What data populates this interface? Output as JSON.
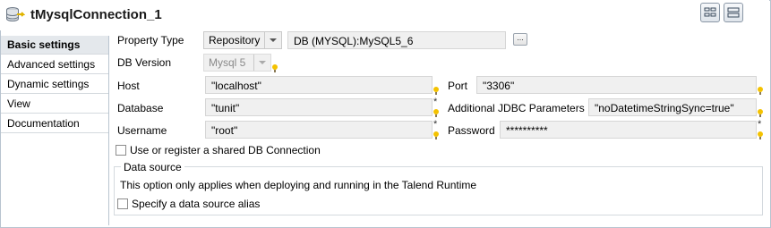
{
  "window": {
    "title": "tMysqlConnection_1",
    "component_icon": "database-icon",
    "view_buttons": [
      "table-layout-icon",
      "form-layout-icon"
    ]
  },
  "sidebar": {
    "items": [
      {
        "label": "Basic settings",
        "active": true
      },
      {
        "label": "Advanced settings",
        "active": false
      },
      {
        "label": "Dynamic settings",
        "active": false
      },
      {
        "label": "View",
        "active": false
      },
      {
        "label": "Documentation",
        "active": false
      }
    ]
  },
  "form": {
    "property_type": {
      "label": "Property Type",
      "value": "Repository",
      "repository_value": "DB (MYSQL):MySQL5_6",
      "browse_label": "..."
    },
    "db_version": {
      "label": "DB Version",
      "value": "Mysql 5"
    },
    "host": {
      "label": "Host",
      "value": "\"localhost\""
    },
    "port": {
      "label": "Port",
      "value": "\"3306\""
    },
    "database": {
      "label": "Database",
      "value": "\"tunit\"",
      "required": "*"
    },
    "jdbc_params": {
      "label": "Additional JDBC Parameters",
      "value": "\"noDatetimeStringSync=true\""
    },
    "username": {
      "label": "Username",
      "value": "\"root\"",
      "required": "*"
    },
    "password": {
      "label": "Password",
      "value": "**********",
      "required": "*"
    },
    "shared_connection": {
      "label": "Use or register a shared DB Connection",
      "checked": false
    }
  },
  "data_source": {
    "title": "Data source",
    "note": "This option only applies when deploying and running in the Talend Runtime",
    "alias": {
      "label": "Specify a data source alias",
      "checked": false
    }
  },
  "colors": {
    "border": "#b8c4cf",
    "field_bg": "#f0f0f0",
    "active_tab_bg": "#e4e8ec",
    "hint_bulb": "#f4c200"
  }
}
